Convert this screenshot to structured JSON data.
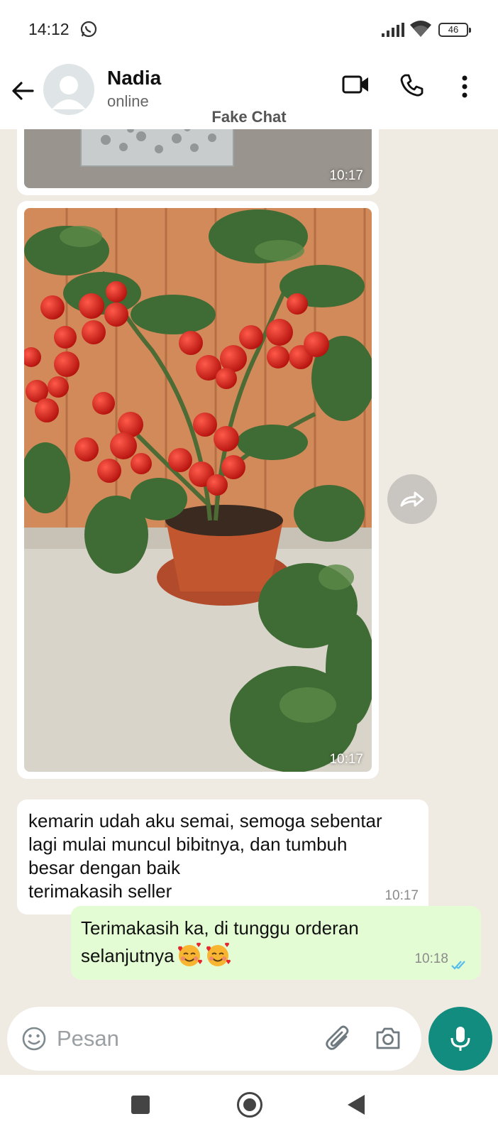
{
  "status_bar": {
    "time": "14:12",
    "battery": "46",
    "icons": [
      "whatsapp-icon",
      "signal-icon",
      "wifi-icon",
      "battery-icon"
    ]
  },
  "header": {
    "contact_name": "Nadia",
    "contact_status": "online",
    "watermark": "Fake Chat",
    "icons": [
      "back-arrow-icon",
      "avatar",
      "video-call-icon",
      "voice-call-icon",
      "more-options-icon"
    ]
  },
  "messages": [
    {
      "type": "image",
      "direction": "in",
      "time": "10:17"
    },
    {
      "type": "image",
      "direction": "in",
      "time": "10:17"
    },
    {
      "type": "text",
      "direction": "in",
      "lines": [
        "kemarin udah aku semai, semoga sebentar",
        "lagi mulai muncul bibitnya, dan tumbuh",
        "besar dengan baik",
        "terimakasih seller"
      ],
      "time": "10:17"
    },
    {
      "type": "text",
      "direction": "out",
      "lines": [
        "Terimakasih ka, di tunggu orderan",
        "selanjutnya"
      ],
      "emoji": [
        "smiling-face-with-hearts",
        "smiling-face-with-hearts"
      ],
      "time": "10:18",
      "status": "read"
    }
  ],
  "composer": {
    "placeholder": "Pesan",
    "icons": [
      "emoji-icon",
      "attach-icon",
      "camera-icon",
      "mic-icon"
    ]
  },
  "colors": {
    "chat_background": "#efeae2",
    "incoming_bubble": "#ffffff",
    "outgoing_bubble": "#e4fcd4",
    "accent": "#128c7e",
    "read_ticks": "#53bdeb"
  }
}
